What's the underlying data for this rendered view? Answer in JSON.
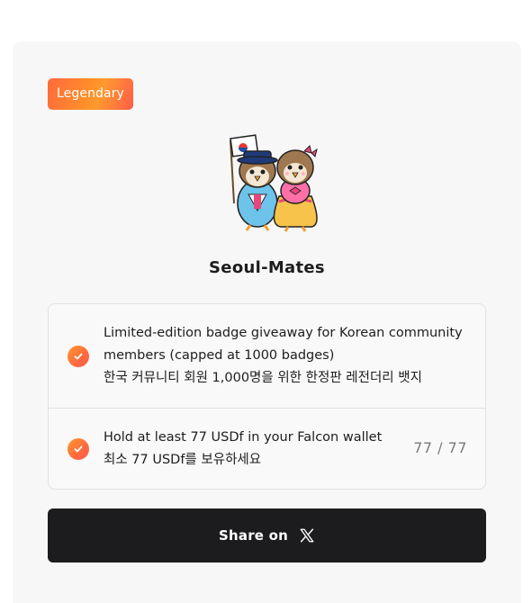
{
  "badge": {
    "tier": "Legendary",
    "name": "Seoul-Mates",
    "mascot_icon": "seoul-mates-mascot-illustration"
  },
  "requirements": [
    {
      "icon": "check-circle-icon",
      "status": "complete",
      "text_en_line1": "Limited-edition badge giveaway for Korean community",
      "text_en_line2": "members (capped at 1000 badges)",
      "text_ko": "한국 커뮤니티 회원 1,000명을 위한 한정판 레전더리 뱃지"
    },
    {
      "icon": "check-circle-icon",
      "status": "complete",
      "text_en": "Hold at least 77 USDf in your Falcon wallet",
      "text_ko": "최소 77 USDf를 보유하세요",
      "progress": "77 / 77"
    }
  ],
  "share": {
    "label": "Share on",
    "icon": "x-logo-icon"
  },
  "colors": {
    "accent_orange": "#ff6a3d",
    "button_dark": "#1c1c1e",
    "card_bg": "#f7f7f7"
  }
}
